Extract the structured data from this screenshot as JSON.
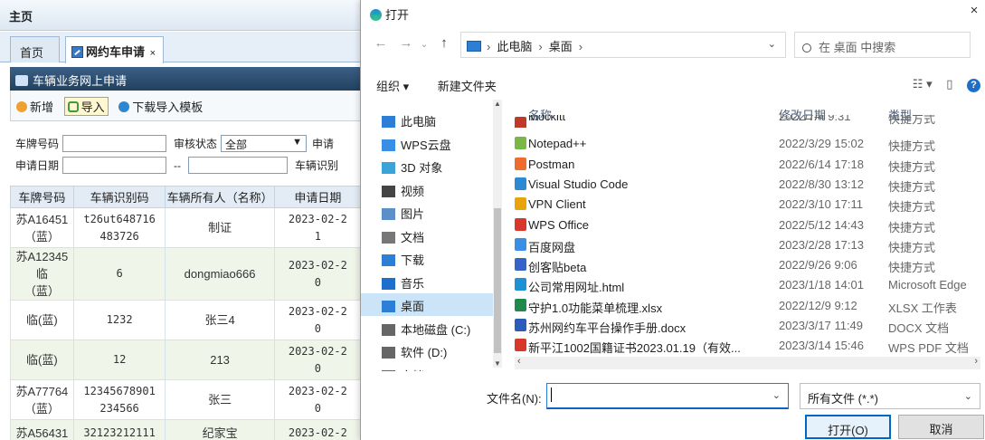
{
  "app": {
    "title": "主页",
    "tabs": [
      {
        "label": "首页"
      },
      {
        "label": "网约车申请",
        "close": "×"
      }
    ],
    "panel_title": "车辆业务网上申请",
    "toolbar": {
      "add": "新增",
      "import": "导入",
      "download": "下载导入模板"
    },
    "filters": {
      "plate_label": "车牌号码",
      "status_label": "审核状态",
      "status_value": "全部",
      "apply_label_trunc": "申请",
      "date_label": "申请日期",
      "date_sep": "--",
      "vin_label_trunc": "车辆识别"
    },
    "table": {
      "headers": [
        "车牌号码",
        "车辆识别码",
        "车辆所有人（名称）",
        "申请日期"
      ],
      "rows": [
        {
          "plate": "苏A16451\n（蓝）",
          "vin": "t26ut648716\n483726",
          "owner": "制证",
          "date": "2023-02-2\n1"
        },
        {
          "plate": "苏A12345临\n（蓝）",
          "vin": "6",
          "owner": "dongmiao666",
          "date": "2023-02-2\n0"
        },
        {
          "plate": "临(蓝)",
          "vin": "1232",
          "owner": "张三4",
          "date": "2023-02-2\n0"
        },
        {
          "plate": "临(蓝)",
          "vin": "12",
          "owner": "213",
          "date": "2023-02-2\n0"
        },
        {
          "plate": "苏A77764\n（蓝）",
          "vin": "12345678901\n234566",
          "owner": "张三",
          "date": "2023-02-2\n0"
        },
        {
          "plate": "苏A56431",
          "vin": "32123212111",
          "owner": "纪家宝",
          "date": "2023-02-2"
        }
      ]
    }
  },
  "dialog": {
    "title": "打开",
    "close": "×",
    "address": {
      "root": "此电脑",
      "folder": "桌面"
    },
    "search_placeholder": "在 桌面 中搜索",
    "cmd": {
      "organize": "组织 ▾",
      "new_folder": "新建文件夹"
    },
    "nav_items": [
      {
        "label": "此电脑",
        "icon": "pc-icon"
      },
      {
        "label": "WPS云盘",
        "icon": "cloud-icon"
      },
      {
        "label": "3D 对象",
        "icon": "cube-icon"
      },
      {
        "label": "视频",
        "icon": "video-icon"
      },
      {
        "label": "图片",
        "icon": "picture-icon"
      },
      {
        "label": "文档",
        "icon": "document-icon"
      },
      {
        "label": "下载",
        "icon": "download-icon"
      },
      {
        "label": "音乐",
        "icon": "music-icon"
      },
      {
        "label": "桌面",
        "icon": "desktop-icon",
        "selected": true
      },
      {
        "label": "本地磁盘 (C:)",
        "icon": "drive-icon"
      },
      {
        "label": "软件 (D:)",
        "icon": "drive-icon"
      },
      {
        "label": "文档 (E:)",
        "icon": "drive-icon"
      }
    ],
    "columns": {
      "name": "名称",
      "date": "修改日期",
      "type": "类型"
    },
    "files": [
      {
        "name": "Mockitt",
        "date": "2022/7/4 9:31",
        "type": "快捷方式",
        "color": "#c0392b"
      },
      {
        "name": "Notepad++",
        "date": "2022/3/29 15:02",
        "type": "快捷方式",
        "color": "#7ab648"
      },
      {
        "name": "Postman",
        "date": "2022/6/14 17:18",
        "type": "快捷方式",
        "color": "#ef6c2e"
      },
      {
        "name": "Visual Studio Code",
        "date": "2022/8/30 13:12",
        "type": "快捷方式",
        "color": "#2b8ad6"
      },
      {
        "name": "VPN Client",
        "date": "2022/3/10 17:11",
        "type": "快捷方式",
        "color": "#e8a40a"
      },
      {
        "name": "WPS Office",
        "date": "2022/5/12 14:43",
        "type": "快捷方式",
        "color": "#d8382b"
      },
      {
        "name": "百度网盘",
        "date": "2023/2/28 17:13",
        "type": "快捷方式",
        "color": "#3a8ee6"
      },
      {
        "name": "创客贴beta",
        "date": "2022/9/26 9:06",
        "type": "快捷方式",
        "color": "#3464c8"
      },
      {
        "name": "公司常用网址.html",
        "date": "2023/1/18 14:01",
        "type": "Microsoft Edge",
        "color": "#1e90d6"
      },
      {
        "name": "守护1.0功能菜单梳理.xlsx",
        "date": "2022/12/9 9:12",
        "type": "XLSX 工作表",
        "color": "#1f8a4c"
      },
      {
        "name": "苏州网约车平台操作手册.docx",
        "date": "2023/3/17 11:49",
        "type": "DOCX 文档",
        "color": "#2b5cb8"
      },
      {
        "name": "新平江1002国籍证书2023.01.19（有效...",
        "date": "2023/3/14 15:46",
        "type": "WPS PDF 文档",
        "color": "#d8382b"
      }
    ],
    "filename_label": "文件名(N):",
    "filename_value": "",
    "filetype": "所有文件 (*.*)",
    "open_button": "打开(O)",
    "cancel_button": "取消"
  }
}
